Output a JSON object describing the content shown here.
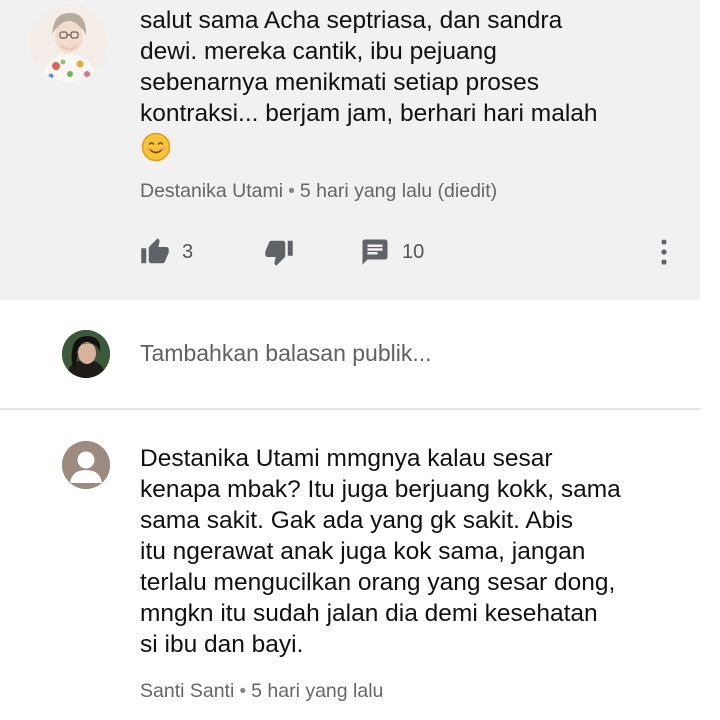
{
  "comments": [
    {
      "lines": [
        "salut sama Acha septriasa, dan sandra",
        "dewi. mereka cantik, ibu pejuang",
        "sebenarnya menikmati setiap proses",
        "kontraksi... berjam jam, berhari hari malah"
      ],
      "emoji": "smiling-face",
      "author": "Destanika Utami",
      "time": "5 hari yang lalu (diedit)",
      "likes": "3",
      "replies": "10"
    },
    {
      "lines": [
        "Destanika Utami mmgnya kalau sesar",
        "kenapa mbak? Itu juga berjuang kokk, sama",
        "sama sakit. Gak ada yang gk sakit. Abis",
        "itu ngerawat anak juga kok sama, jangan",
        "terlalu mengucilkan orang yang sesar dong,",
        "mngkn itu sudah jalan dia demi kesehatan",
        "si ibu dan bayi."
      ],
      "author": "Santi Santi",
      "time": "5 hari yang lalu"
    }
  ],
  "reply_box": {
    "placeholder": "Tambahkan balasan publik..."
  },
  "separator": "•",
  "icons": {
    "like": "thumbs-up-icon",
    "dislike": "thumbs-down-icon",
    "reply": "comment-icon",
    "more": "more-vertical-icon"
  },
  "colors": {
    "comment_bg": "#f1f1f1",
    "text": "#111111",
    "meta": "#666666",
    "icon": "#5f6368"
  }
}
